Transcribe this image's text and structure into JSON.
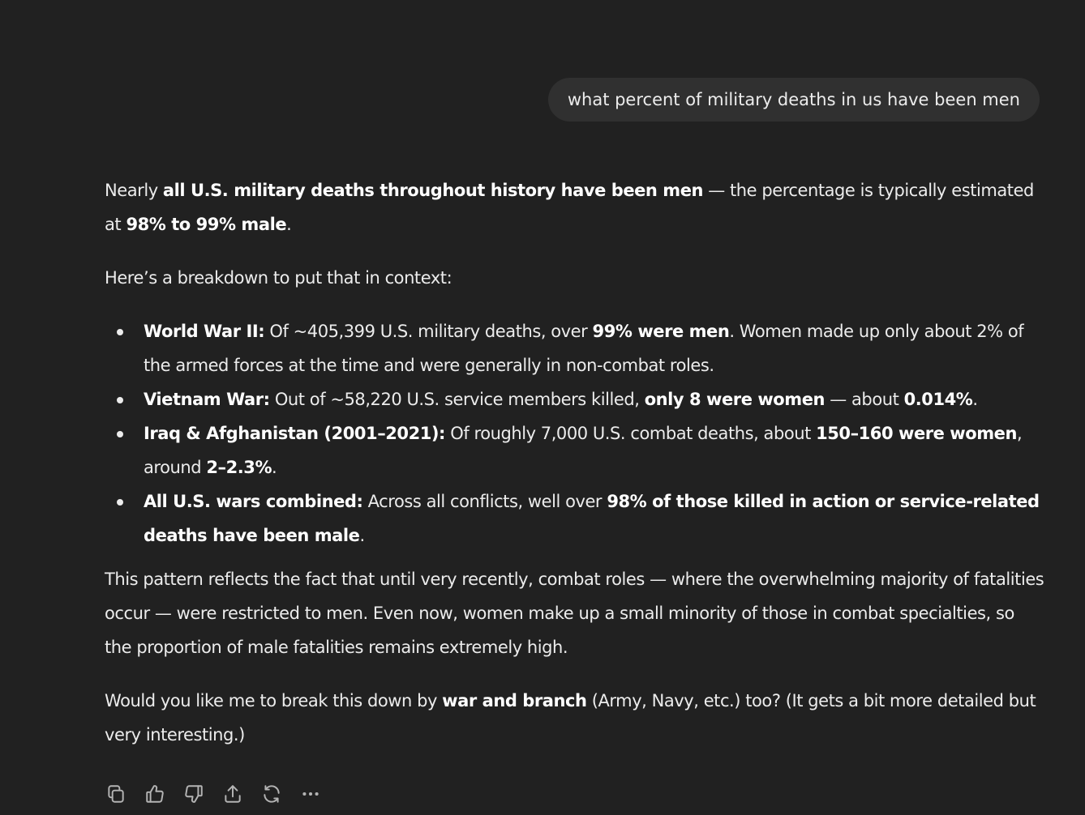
{
  "user_message": "what percent of military deaths in us have been men",
  "response": {
    "p1": {
      "t1": "Nearly ",
      "b1": "all U.S. military deaths throughout history have been men",
      "t2": " — the percentage is typically estimated at ",
      "b2": "98% to 99% male",
      "t3": "."
    },
    "p2": "Here’s a breakdown to put that in context:",
    "bullets": [
      {
        "b1": "World War II:",
        "t1": " Of ~405,399 U.S. military deaths, over ",
        "b2": "99% were men",
        "t2": ". Women made up only about 2% of the armed forces at the time and were generally in non-combat roles."
      },
      {
        "b1": "Vietnam War:",
        "t1": " Out of ~58,220 U.S. service members killed, ",
        "b2": "only 8 were women",
        "t2": " — about ",
        "b3": "0.014%",
        "t3": "."
      },
      {
        "b1": "Iraq & Afghanistan (2001–2021):",
        "t1": " Of roughly 7,000 U.S. combat deaths, about ",
        "b2": "150–160 were women",
        "t2": ", around ",
        "b3": "2–2.3%",
        "t3": "."
      },
      {
        "b1": "All U.S. wars combined:",
        "t1": " Across all conflicts, well over ",
        "b2": "98% of those killed in action or service-related deaths have been male",
        "t2": "."
      }
    ],
    "p3": "This pattern reflects the fact that until very recently, combat roles — where the overwhelming majority of fatalities occur — were restricted to men. Even now, women make up a small minority of those in combat specialties, so the proportion of male fatalities remains extremely high.",
    "p4": {
      "t1": "Would you like me to break this down by ",
      "b1": "war and branch",
      "t2": " (Army, Navy, etc.) too? (It gets a bit more detailed but very interesting.)"
    }
  },
  "actions": {
    "icons": [
      "copy-icon",
      "thumbs-up-icon",
      "thumbs-down-icon",
      "share-icon",
      "regenerate-icon",
      "more-icon"
    ]
  },
  "colors": {
    "background": "#212121",
    "user_bubble": "#303030",
    "text": "#ececec",
    "icon": "#b4b4b4"
  }
}
